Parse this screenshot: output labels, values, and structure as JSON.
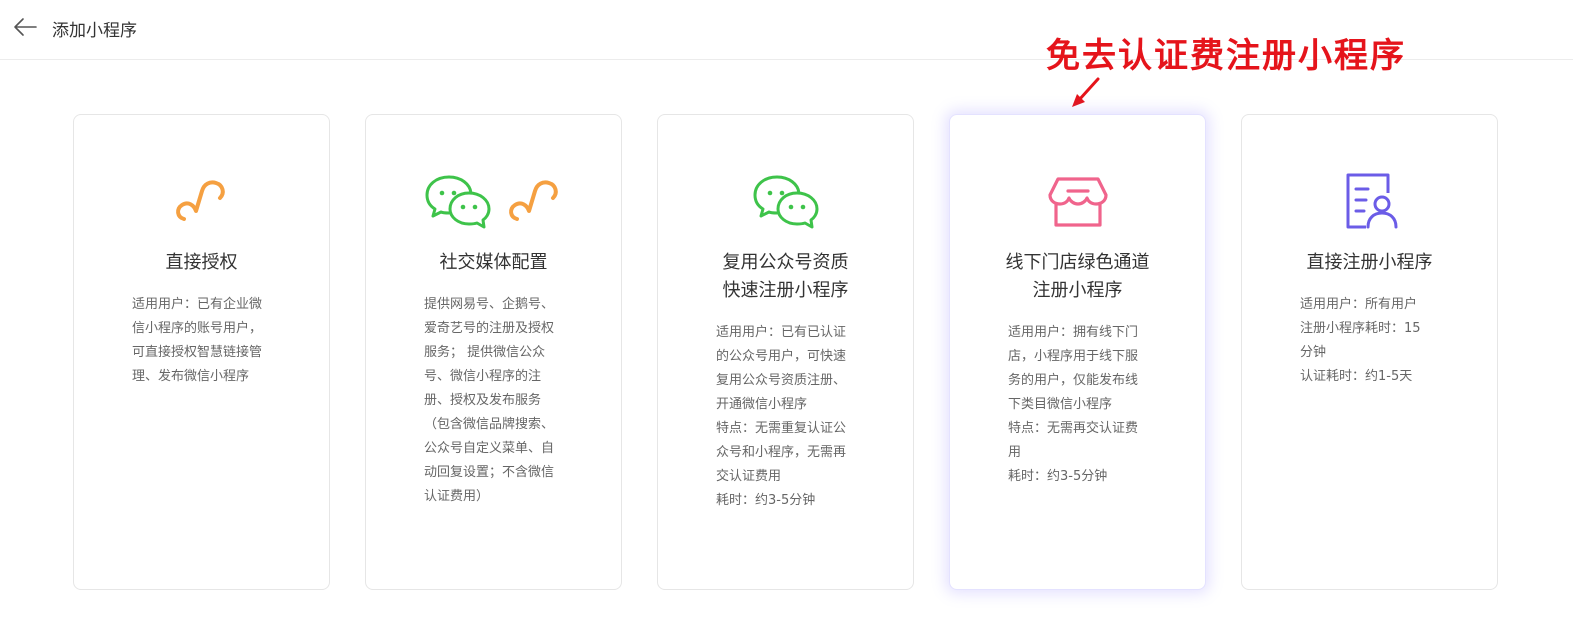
{
  "header": {
    "title": "添加小程序",
    "back_icon": "arrow-left-icon"
  },
  "annotation": {
    "text": "免去认证费注册小程序",
    "color": "#e5141b"
  },
  "cards": [
    {
      "title": "直接授权",
      "icons": [
        "mini-program-icon"
      ],
      "desc": "适用用户：已有企业微\n信小程序的账号用户，\n可直接授权智慧链接管\n理、发布微信小程序"
    },
    {
      "title": "社交媒体配置",
      "icons": [
        "wechat-icon",
        "mini-program-icon"
      ],
      "desc": "提供网易号、企鹅号、\n爱奇艺号的注册及授权\n服务；  提供微信公众\n号、微信小程序的注\n册、授权及发布服务\n（包含微信品牌搜索、\n公众号自定义菜单、自\n动回复设置；不含微信\n认证费用）"
    },
    {
      "title": "复用公众号资质\n快速注册小程序",
      "icons": [
        "wechat-icon"
      ],
      "desc": "适用用户：已有已认证\n的公众号用户，可快速\n复用公众号资质注册、\n开通微信小程序\n特点：无需重复认证公\n众号和小程序，无需再\n交认证费用\n耗时：约3-5分钟"
    },
    {
      "title": "线下门店绿色通道\n注册小程序",
      "icons": [
        "store-icon"
      ],
      "desc": "适用用户：拥有线下门\n店，小程序用于线下服\n务的用户，仅能发布线\n下类目微信小程序\n特点：无需再交认证费\n用\n耗时：约3-5分钟"
    },
    {
      "title": "直接注册小程序",
      "icons": [
        "register-form-icon"
      ],
      "desc": "适用用户：所有用户\n注册小程序耗时：15\n分钟\n认证耗时：约1-5天"
    }
  ],
  "colors": {
    "mini_program_orange": "#f5a041",
    "wechat_green": "#3ec34a",
    "store_pink": "#f0648c",
    "register_purple": "#6b5ce7",
    "highlight_glow": "#8a7aff"
  }
}
